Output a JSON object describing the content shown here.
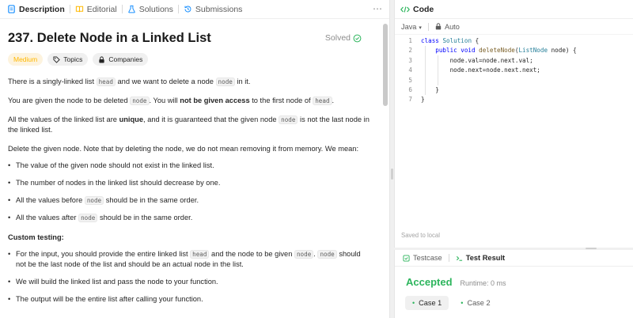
{
  "tabs": {
    "description": "Description",
    "editorial": "Editorial",
    "solutions": "Solutions",
    "submissions": "Submissions",
    "more": "⋯"
  },
  "problem": {
    "title": "237. Delete Node in a Linked List",
    "solved": "Solved",
    "difficulty": "Medium",
    "topics": "Topics",
    "companies": "Companies"
  },
  "description": {
    "p1": {
      "a": "There is a singly-linked list ",
      "c1": "head",
      "b": " and we want to delete a node ",
      "c2": "node",
      "d": " in it."
    },
    "p2": {
      "a": "You are given the node to be deleted ",
      "c1": "node",
      "b": ". You will ",
      "bold": "not be given access",
      "d": " to the first node of ",
      "c2": "head",
      "e": "."
    },
    "p3": {
      "a": "All the values of the linked list are ",
      "bold": "unique",
      "b": ", and it is guaranteed that the given node ",
      "c1": "node",
      "d": " is not the last node in the linked list."
    },
    "p4": "Delete the given node. Note that by deleting the node, we do not mean removing it from memory. We mean:",
    "bullets": {
      "b1": "The value of the given node should not exist in the linked list.",
      "b2": "The number of nodes in the linked list should decrease by one.",
      "b3": {
        "a": "All the values before ",
        "c": "node",
        "b": " should be in the same order."
      },
      "b4": {
        "a": "All the values after ",
        "c": "node",
        "b": " should be in the same order."
      }
    },
    "custom_heading": "Custom testing:",
    "custom": {
      "c1": {
        "a": "For the input, you should provide the entire linked list ",
        "k1": "head",
        "b": " and the node to be given ",
        "k2": "node",
        "d": ". ",
        "k3": "node",
        "e": " should not be the last node of the list and should be an actual node in the list."
      },
      "c2": "We will build the linked list and pass the node to your function.",
      "c3": "The output will be the entire list after calling your function."
    }
  },
  "code_panel": {
    "title": "Code",
    "language": "Java",
    "mode": "Auto",
    "lines": {
      "n1": "1",
      "n2": "2",
      "n3": "3",
      "n4": "4",
      "n5": "5",
      "n6": "6",
      "n7": "7",
      "l1a": "class ",
      "l1b": "Solution",
      "l1c": " {",
      "l2a": "    public void ",
      "l2b": "deleteNode",
      "l2c": "(",
      "l2d": "ListNode",
      "l2e": " node) {",
      "l3": "        node.val=node.next.val;",
      "l4": "        node.next=node.next.next;",
      "l5": "",
      "l6": "    }",
      "l7": "}"
    },
    "saved": "Saved to local"
  },
  "result_panel": {
    "testcase_tab": "Testcase",
    "result_tab": "Test Result",
    "status": "Accepted",
    "runtime": "Runtime: 0 ms",
    "case1": "Case 1",
    "case2": "Case 2"
  },
  "colors": {
    "accepted": "#2db55d",
    "medium": "#ffb800",
    "description_icon": "#1a90ff",
    "editorial_icon": "#ffb800",
    "solutions_icon": "#1a90ff",
    "code_icon": "#2db55d"
  }
}
